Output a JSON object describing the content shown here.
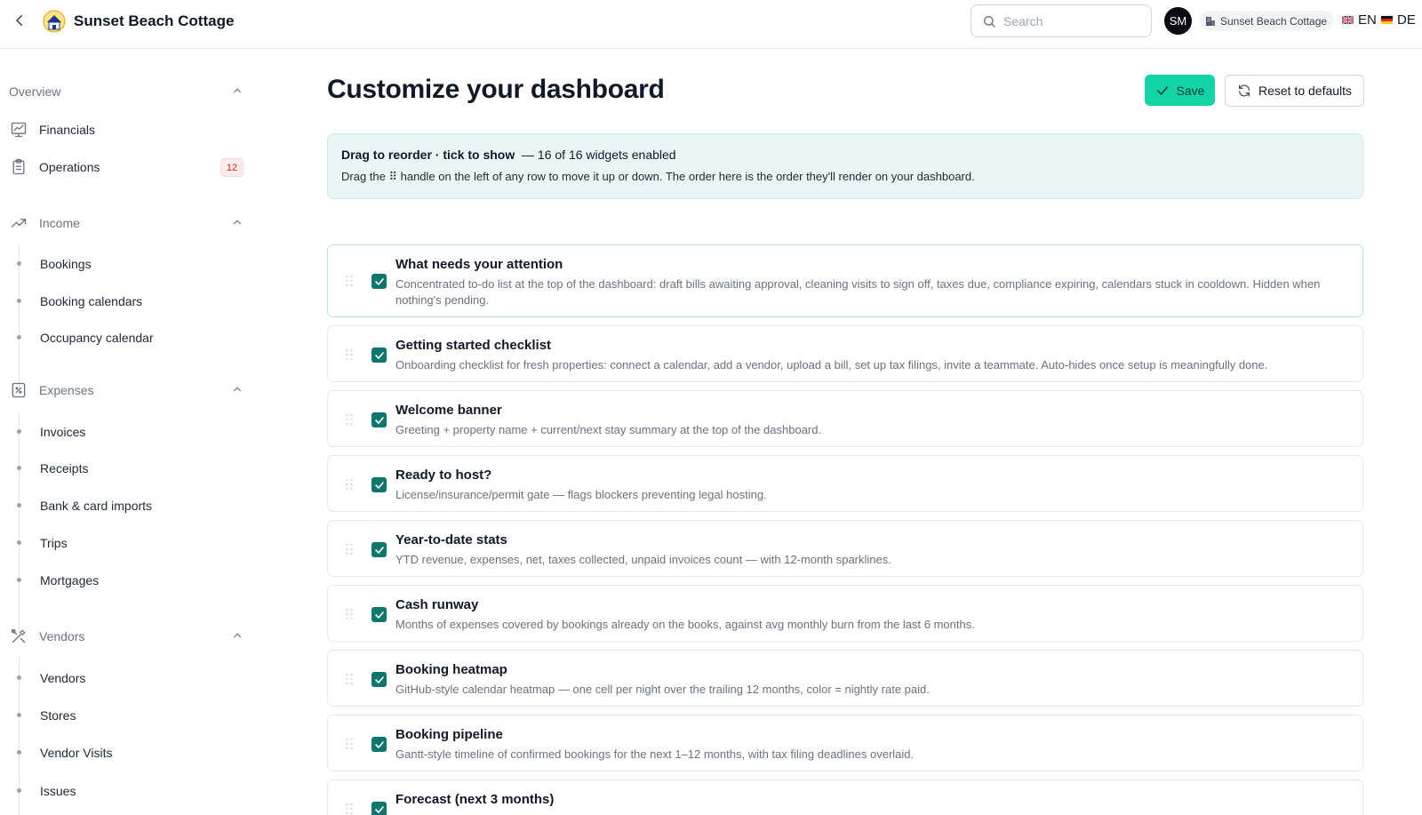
{
  "header": {
    "app_title": "Sunset Beach Cottage",
    "search_placeholder": "Search",
    "avatar_initials": "SM",
    "property_chip": "Sunset Beach Cottage",
    "lang_en": "EN",
    "lang_de": "DE"
  },
  "sidebar": {
    "overview": {
      "label": "Overview",
      "items": [
        {
          "label": "Financials"
        },
        {
          "label": "Operations",
          "badge": "12"
        }
      ]
    },
    "income": {
      "label": "Income",
      "items": [
        {
          "label": "Bookings"
        },
        {
          "label": "Booking calendars"
        },
        {
          "label": "Occupancy calendar"
        }
      ]
    },
    "expenses": {
      "label": "Expenses",
      "items": [
        {
          "label": "Invoices"
        },
        {
          "label": "Receipts"
        },
        {
          "label": "Bank & card imports"
        },
        {
          "label": "Trips"
        },
        {
          "label": "Mortgages"
        }
      ]
    },
    "vendors": {
      "label": "Vendors",
      "items": [
        {
          "label": "Vendors"
        },
        {
          "label": "Stores"
        },
        {
          "label": "Vendor Visits"
        },
        {
          "label": "Issues"
        }
      ]
    }
  },
  "main": {
    "title": "Customize your dashboard",
    "save_label": "Save",
    "reset_label": "Reset to defaults",
    "info": {
      "bold": "Drag to reorder · tick to show",
      "count": "— 16 of 16 widgets enabled",
      "help": "Drag the ⠿ handle on the left of any row to move it up or down. The order here is the order they'll render on your dashboard."
    },
    "widgets": [
      {
        "title": "What needs your attention",
        "desc": "Concentrated to-do list at the top of the dashboard: draft bills awaiting approval, cleaning visits to sign off, taxes due, compliance expiring, calendars stuck in cooldown. Hidden when nothing's pending.",
        "enabled": true
      },
      {
        "title": "Getting started checklist",
        "desc": "Onboarding checklist for fresh properties: connect a calendar, add a vendor, upload a bill, set up tax filings, invite a teammate. Auto-hides once setup is meaningfully done.",
        "enabled": true
      },
      {
        "title": "Welcome banner",
        "desc": "Greeting + property name + current/next stay summary at the top of the dashboard.",
        "enabled": true
      },
      {
        "title": "Ready to host?",
        "desc": "License/insurance/permit gate — flags blockers preventing legal hosting.",
        "enabled": true
      },
      {
        "title": "Year-to-date stats",
        "desc": "YTD revenue, expenses, net, taxes collected, unpaid invoices count — with 12-month sparklines.",
        "enabled": true
      },
      {
        "title": "Cash runway",
        "desc": "Months of expenses covered by bookings already on the books, against avg monthly burn from the last 6 months.",
        "enabled": true
      },
      {
        "title": "Booking heatmap",
        "desc": "GitHub-style calendar heatmap — one cell per night over the trailing 12 months, color = nightly rate paid.",
        "enabled": true
      },
      {
        "title": "Booking pipeline",
        "desc": "Gantt-style timeline of confirmed bookings for the next 1–12 months, with tax filing deadlines overlaid.",
        "enabled": true
      },
      {
        "title": "Forecast (next 3 months)",
        "desc": "",
        "enabled": true
      }
    ]
  },
  "colors": {
    "accent": "#14d3a6",
    "checkbox": "#0f766e",
    "info_bg": "#eaf6f5",
    "badge_text": "#dc2626"
  }
}
